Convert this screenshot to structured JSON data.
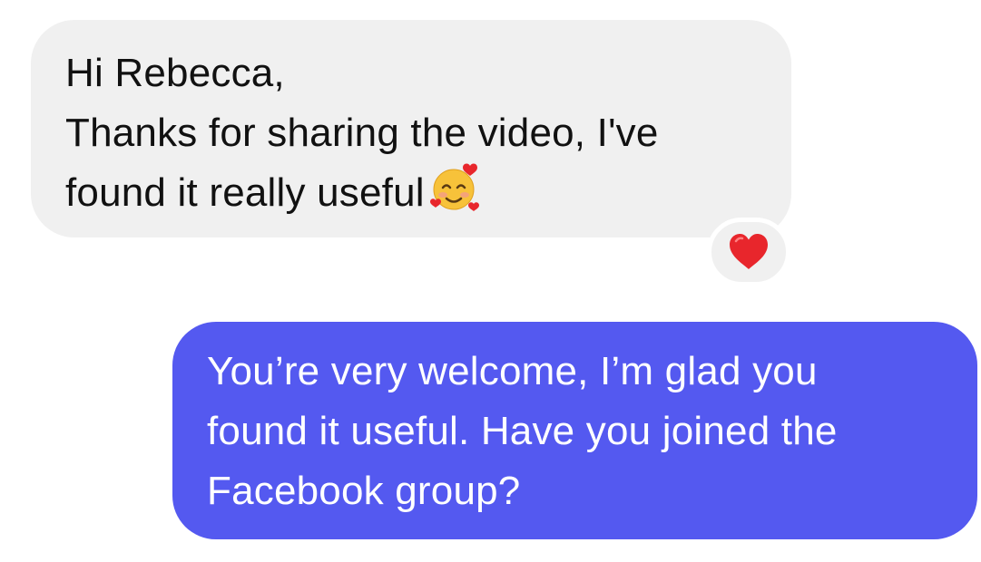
{
  "conversation": {
    "incoming": {
      "lines": [
        "Hi Rebecca,",
        "Thanks for sharing the video, I've",
        "found it really useful"
      ],
      "emoji": "smiling-face-with-hearts-icon",
      "reaction": "red-heart-icon",
      "bubble_color": "#f0f0f0",
      "text_color": "#111111"
    },
    "outgoing": {
      "lines": [
        "You’re very welcome, I’m glad you",
        "found it useful. Have you joined the",
        "Facebook group?"
      ],
      "bubble_color": "#5459f0",
      "text_color": "#ffffff"
    },
    "reaction_color": "#e8262c"
  }
}
